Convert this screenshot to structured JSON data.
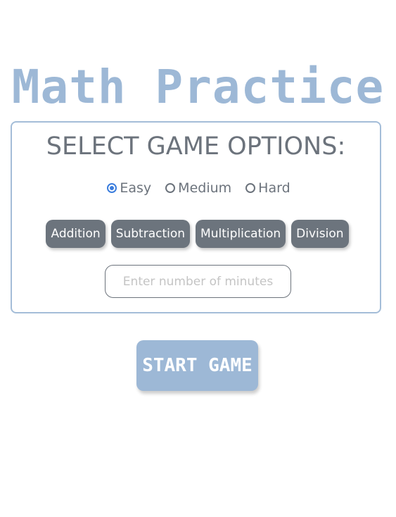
{
  "title": "Math Practice",
  "options": {
    "heading": "SELECT GAME OPTIONS:",
    "difficulty": [
      {
        "label": "Easy",
        "checked": true
      },
      {
        "label": "Medium",
        "checked": false
      },
      {
        "label": "Hard",
        "checked": false
      }
    ],
    "operations": [
      "Addition",
      "Subtraction",
      "Multiplication",
      "Division"
    ],
    "minutes_placeholder": "Enter number of minutes",
    "minutes_value": ""
  },
  "start_button_label": "START GAME",
  "colors": {
    "accent": "#9db8d6",
    "operation_button": "#6c747d",
    "text": "#6c737c",
    "radio_selected": "#3b7ddd"
  }
}
